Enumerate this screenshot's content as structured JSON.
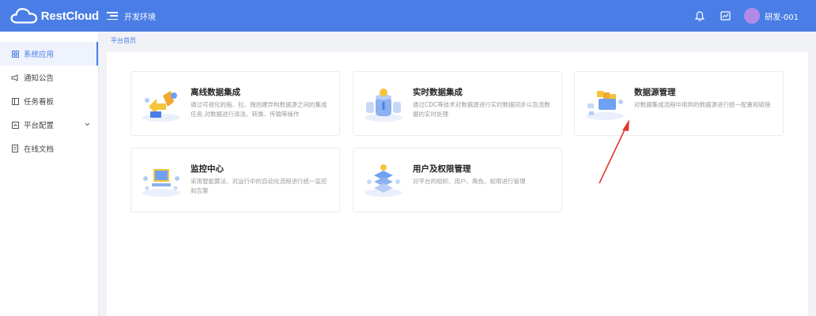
{
  "header": {
    "logo_text": "RestCloud",
    "env_label": "开发环境",
    "username": "研发-001",
    "icons": [
      "bell-icon",
      "chart-screen-icon",
      "chevron-down-icon"
    ]
  },
  "sidebar": {
    "items": [
      {
        "label": "系统应用",
        "icon": "grid-icon",
        "active": true
      },
      {
        "label": "通知公告",
        "icon": "megaphone-icon"
      },
      {
        "label": "任务看板",
        "icon": "board-icon"
      },
      {
        "label": "平台配置",
        "icon": "config-icon",
        "has_arrow": true
      },
      {
        "label": "在线文档",
        "icon": "document-icon"
      }
    ]
  },
  "breadcrumb": "平台首页",
  "cards": [
    {
      "title": "离线数据集成",
      "desc": "通过可视化的拖、拉、拽创建异构数据源之间的集成任务,对数据进行清洗、转换、传输等操作",
      "icon": "etl-illustration-icon"
    },
    {
      "title": "实时数据集成",
      "desc": "通过CDC等技术对数据源进行实时数据同步以及流数据的实时处理",
      "icon": "realtime-db-illustration-icon"
    },
    {
      "title": "数据源管理",
      "desc": "对数据集成流程中用到的数据源进行统一配置和链接",
      "icon": "datasource-illustration-icon"
    },
    {
      "title": "监控中心",
      "desc": "采用智能算法、对运行中的自动化流程进行统一监控和告警",
      "icon": "monitor-illustration-icon"
    },
    {
      "title": "用户及权限管理",
      "desc": "对平台的组织、用户、角色、权限进行管理",
      "icon": "user-permission-illustration-icon"
    }
  ],
  "colors": {
    "brand": "#4a7ee6",
    "annotation_arrow": "#e0382e"
  }
}
